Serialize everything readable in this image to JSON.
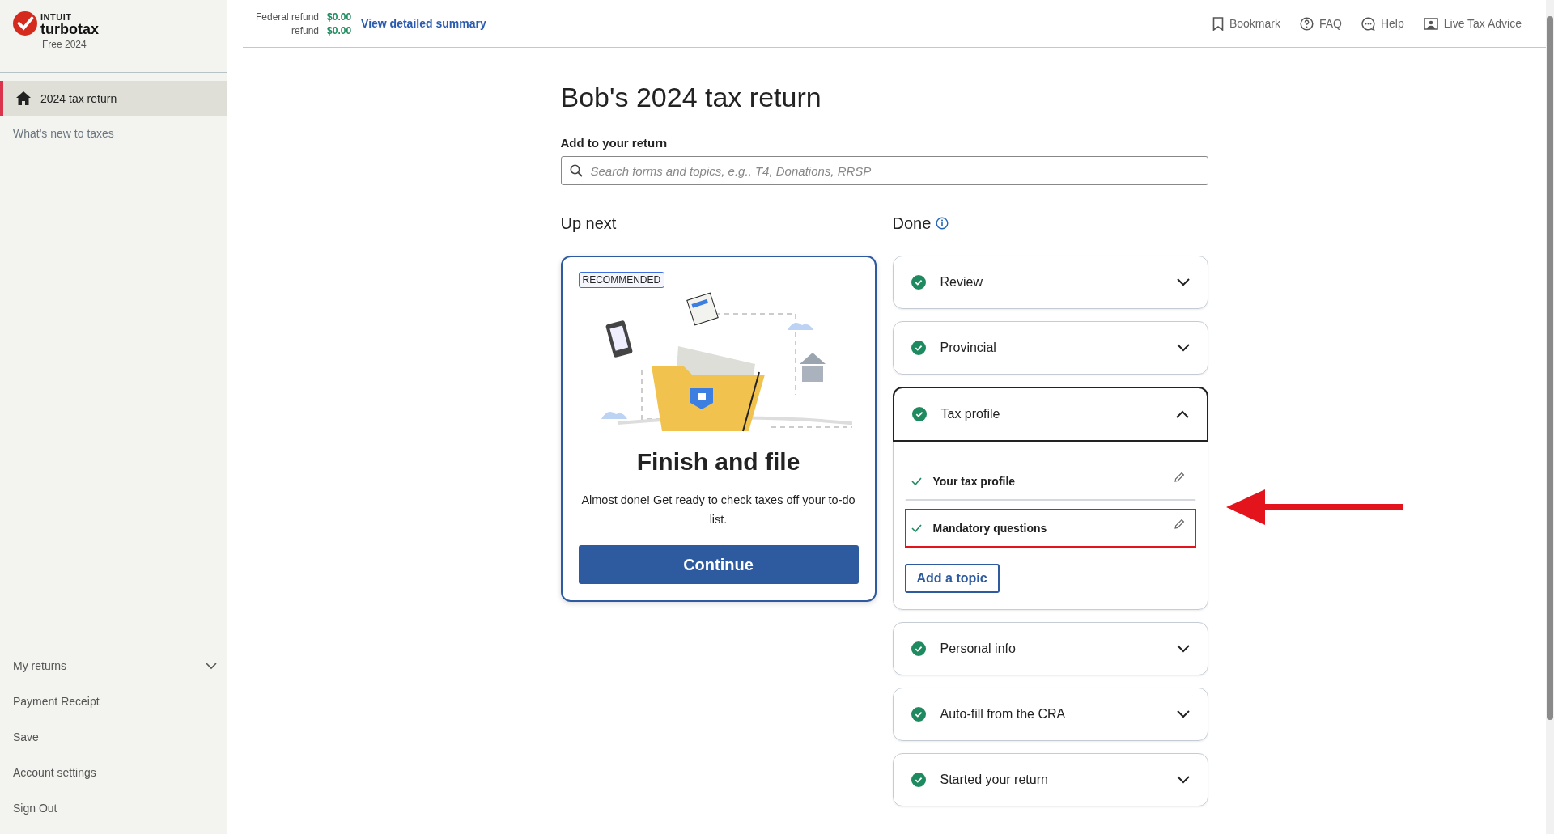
{
  "brand": {
    "company": "INTUIT",
    "product": "turbotax",
    "edition": "Free 2024"
  },
  "sidebar": {
    "items": [
      {
        "label": "2024 tax return",
        "selected": true,
        "kind": "home"
      },
      {
        "label": "What's new to taxes",
        "selected": false
      }
    ],
    "bottom_items": [
      {
        "label": "My returns",
        "kind": "dropdown",
        "expanded": false
      },
      {
        "label": "Payment Receipt",
        "kind": "link"
      },
      {
        "label": "Save",
        "kind": "link"
      },
      {
        "label": "Account settings",
        "kind": "link"
      },
      {
        "label": "Sign Out",
        "kind": "link"
      }
    ]
  },
  "header": {
    "refunds": [
      {
        "label": "Federal refund",
        "amount": "$0.00"
      },
      {
        "label": "refund",
        "amount": "$0.00"
      }
    ],
    "summary_link": "View detailed summary",
    "actions": [
      {
        "label": "Bookmark",
        "kind": "bookmark"
      },
      {
        "label": "FAQ",
        "kind": "faq"
      },
      {
        "label": "Help",
        "kind": "help"
      },
      {
        "label": "Live Tax Advice",
        "kind": "advice"
      }
    ]
  },
  "page_title": "Bob's 2024 tax return",
  "search": {
    "label": "Add to your return",
    "placeholder": "Search forms and topics, e.g., T4, Donations, RRSP"
  },
  "up_next": {
    "heading": "Up next",
    "badge": "RECOMMENDED",
    "title": "Finish and file",
    "text": "Almost done! Get ready to check taxes off your to-do list.",
    "button": "Continue"
  },
  "done": {
    "heading": "Done",
    "sections": [
      {
        "title": "Review",
        "expanded": false
      },
      {
        "title": "Provincial",
        "expanded": false
      },
      {
        "title": "Tax profile",
        "expanded": true,
        "items": [
          {
            "label": "Your tax profile",
            "highlighted": false
          },
          {
            "label": "Mandatory questions",
            "highlighted": true
          }
        ],
        "button": "Add a topic"
      },
      {
        "title": "Personal info",
        "expanded": false
      },
      {
        "title": "Auto-fill from the CRA",
        "expanded": false
      },
      {
        "title": "Started your return",
        "expanded": false
      }
    ]
  }
}
